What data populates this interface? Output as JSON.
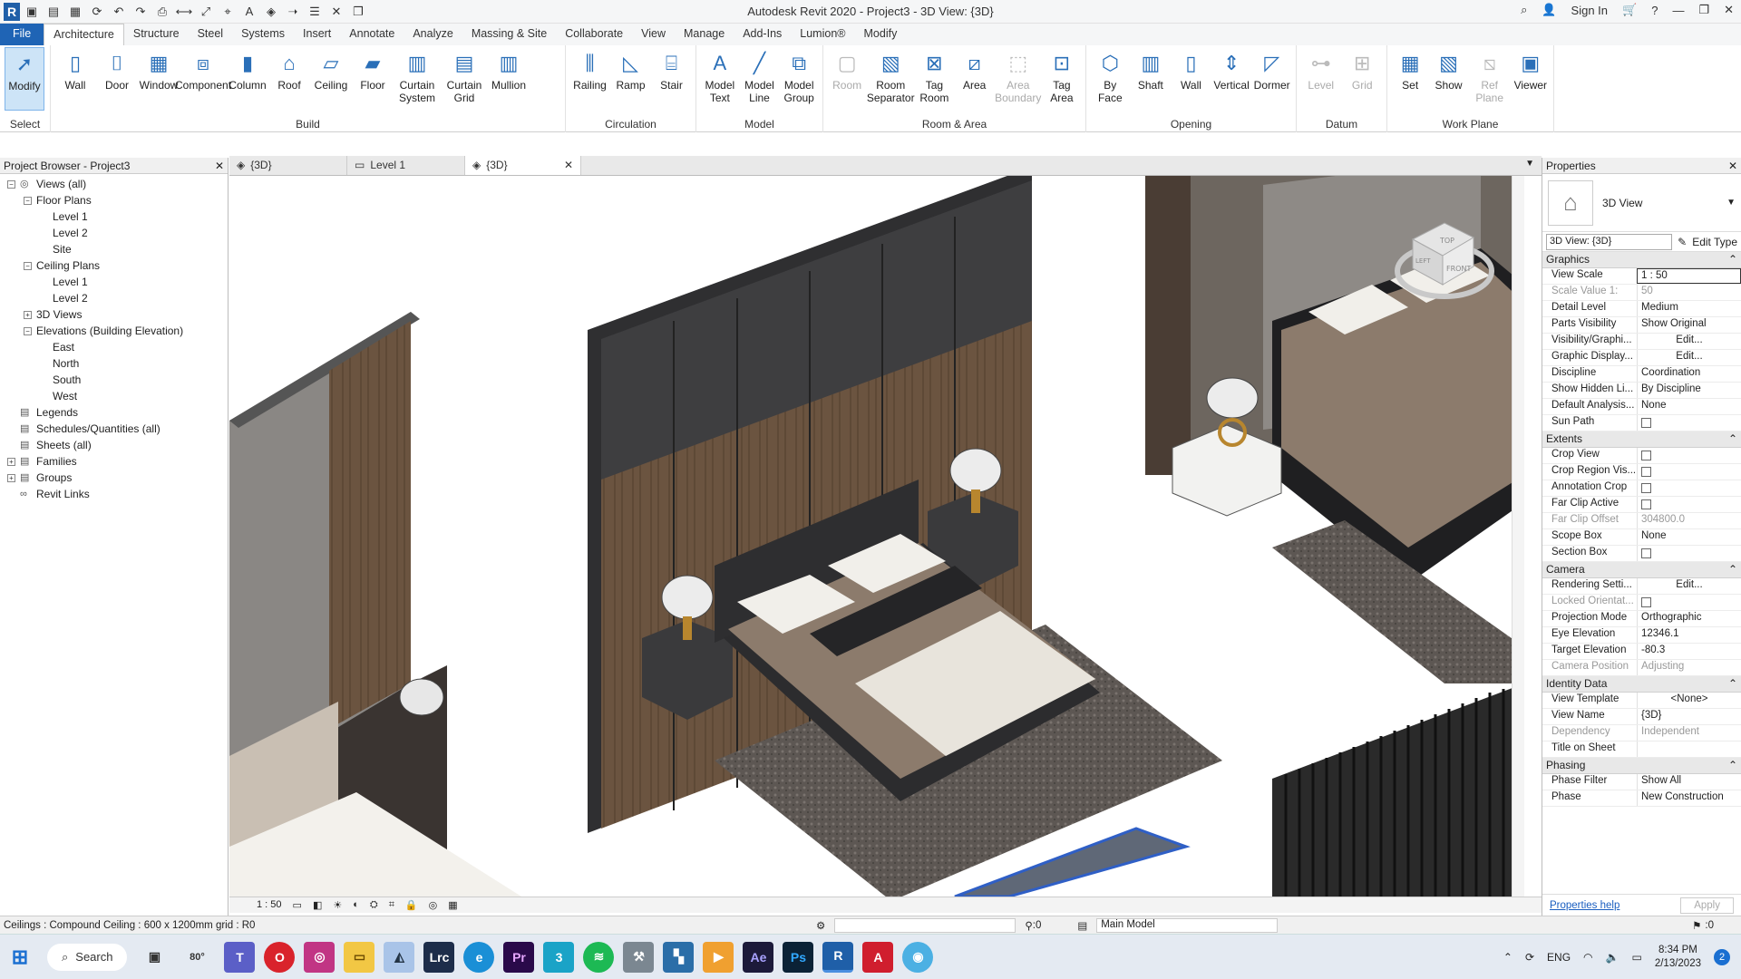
{
  "window": {
    "title": "Autodesk Revit 2020 - Project3 - 3D View: {3D}",
    "sign_in": "Sign In"
  },
  "menu": [
    "File",
    "Architecture",
    "Structure",
    "Steel",
    "Systems",
    "Insert",
    "Annotate",
    "Analyze",
    "Massing & Site",
    "Collaborate",
    "View",
    "Manage",
    "Add-Ins",
    "Lumion®",
    "Modify"
  ],
  "ribbon": {
    "select": {
      "button": "Modify",
      "label": "Select"
    },
    "build": {
      "label": "Build",
      "buttons": [
        "Wall",
        "Door",
        "Window",
        "Component",
        "Column",
        "Roof",
        "Ceiling",
        "Floor",
        "Curtain\nSystem",
        "Curtain\nGrid",
        "Mullion"
      ]
    },
    "circulation": {
      "label": "Circulation",
      "buttons": [
        "Railing",
        "Ramp",
        "Stair"
      ]
    },
    "model": {
      "label": "Model",
      "buttons": [
        "Model\nText",
        "Model\nLine",
        "Model\nGroup"
      ]
    },
    "room": {
      "label": "Room & Area",
      "buttons": [
        "Room",
        "Room\nSeparator",
        "Tag\nRoom",
        "Area",
        "Area\nBoundary",
        "Tag\nArea"
      ]
    },
    "opening": {
      "label": "Opening",
      "buttons": [
        "By\nFace",
        "Shaft",
        "Wall",
        "Vertical",
        "Dormer"
      ]
    },
    "datum": {
      "label": "Datum",
      "buttons": [
        "Level",
        "Grid"
      ]
    },
    "workplane": {
      "label": "Work Plane",
      "buttons": [
        "Set",
        "Show",
        "Ref\nPlane",
        "Viewer"
      ]
    }
  },
  "browser": {
    "title": "Project Browser - Project3",
    "tree": [
      {
        "label": "Views (all)",
        "level": 0,
        "tog": "−"
      },
      {
        "label": "Floor Plans",
        "level": 1,
        "tog": "−"
      },
      {
        "label": "Level 1",
        "level": 2,
        "tog": ""
      },
      {
        "label": "Level 2",
        "level": 2,
        "tog": ""
      },
      {
        "label": "Site",
        "level": 2,
        "tog": ""
      },
      {
        "label": "Ceiling Plans",
        "level": 1,
        "tog": "−"
      },
      {
        "label": "Level 1",
        "level": 2,
        "tog": ""
      },
      {
        "label": "Level 2",
        "level": 2,
        "tog": ""
      },
      {
        "label": "3D Views",
        "level": 1,
        "tog": "+"
      },
      {
        "label": "Elevations (Building Elevation)",
        "level": 1,
        "tog": "−"
      },
      {
        "label": "East",
        "level": 2,
        "tog": ""
      },
      {
        "label": "North",
        "level": 2,
        "tog": ""
      },
      {
        "label": "South",
        "level": 2,
        "tog": ""
      },
      {
        "label": "West",
        "level": 2,
        "tog": ""
      },
      {
        "label": "Legends",
        "level": 0,
        "tog": ""
      },
      {
        "label": "Schedules/Quantities (all)",
        "level": 0,
        "tog": ""
      },
      {
        "label": "Sheets (all)",
        "level": 0,
        "tog": ""
      },
      {
        "label": "Families",
        "level": 0,
        "tog": "+"
      },
      {
        "label": "Groups",
        "level": 0,
        "tog": "+"
      },
      {
        "label": "Revit Links",
        "level": 0,
        "tog": ""
      }
    ]
  },
  "tabs": [
    {
      "label": "{3D}"
    },
    {
      "label": "Level 1"
    },
    {
      "label": "{3D}"
    }
  ],
  "viewcube": {
    "top": "TOP",
    "front": "FRONT",
    "left": "LEFT"
  },
  "view_status": {
    "scale": "1 : 50"
  },
  "properties": {
    "title": "Properties",
    "type_name": "3D View",
    "selector": "3D View: {3D}",
    "edit_type": "Edit Type",
    "sections": [
      {
        "name": "Graphics",
        "rows": [
          {
            "k": "View Scale",
            "v": "1 : 50"
          },
          {
            "k": "Scale Value    1:",
            "v": "50",
            "ro": true
          },
          {
            "k": "Detail Level",
            "v": "Medium"
          },
          {
            "k": "Parts Visibility",
            "v": "Show Original"
          },
          {
            "k": "Visibility/Graphi...",
            "v": "Edit...",
            "btn": true
          },
          {
            "k": "Graphic Display...",
            "v": "Edit...",
            "btn": true
          },
          {
            "k": "Discipline",
            "v": "Coordination"
          },
          {
            "k": "Show Hidden Li...",
            "v": "By Discipline"
          },
          {
            "k": "Default Analysis...",
            "v": "None"
          },
          {
            "k": "Sun Path",
            "v": "",
            "chk": true
          }
        ]
      },
      {
        "name": "Extents",
        "rows": [
          {
            "k": "Crop View",
            "v": "",
            "chk": true
          },
          {
            "k": "Crop Region Vis...",
            "v": "",
            "chk": true
          },
          {
            "k": "Annotation Crop",
            "v": "",
            "chk": true
          },
          {
            "k": "Far Clip Active",
            "v": "",
            "chk": true
          },
          {
            "k": "Far Clip Offset",
            "v": "304800.0",
            "ro": true
          },
          {
            "k": "Scope Box",
            "v": "None"
          },
          {
            "k": "Section Box",
            "v": "",
            "chk": true
          }
        ]
      },
      {
        "name": "Camera",
        "rows": [
          {
            "k": "Rendering Setti...",
            "v": "Edit...",
            "btn": true
          },
          {
            "k": "Locked Orientat...",
            "v": "",
            "chk": true,
            "ro": true
          },
          {
            "k": "Projection Mode",
            "v": "Orthographic"
          },
          {
            "k": "Eye Elevation",
            "v": "12346.1"
          },
          {
            "k": "Target Elevation",
            "v": "-80.3"
          },
          {
            "k": "Camera Position",
            "v": "Adjusting",
            "ro": true
          }
        ]
      },
      {
        "name": "Identity Data",
        "rows": [
          {
            "k": "View Template",
            "v": "<None>",
            "btn": true
          },
          {
            "k": "View Name",
            "v": "{3D}"
          },
          {
            "k": "Dependency",
            "v": "Independent",
            "ro": true
          },
          {
            "k": "Title on Sheet",
            "v": ""
          }
        ]
      },
      {
        "name": "Phasing",
        "rows": [
          {
            "k": "Phase Filter",
            "v": "Show All"
          },
          {
            "k": "Phase",
            "v": "New Construction"
          }
        ]
      }
    ],
    "help": "Properties help",
    "apply": "Apply"
  },
  "status": {
    "text": "Ceilings : Compound Ceiling : 600 x 1200mm grid : R0",
    "sel_count": ":0",
    "model": "Main Model",
    "filter": ":0"
  },
  "taskbar": {
    "search": "Search",
    "weather": "80°",
    "lang": "ENG",
    "time": "8:34 PM",
    "date": "2/13/2023",
    "badge": "2"
  }
}
